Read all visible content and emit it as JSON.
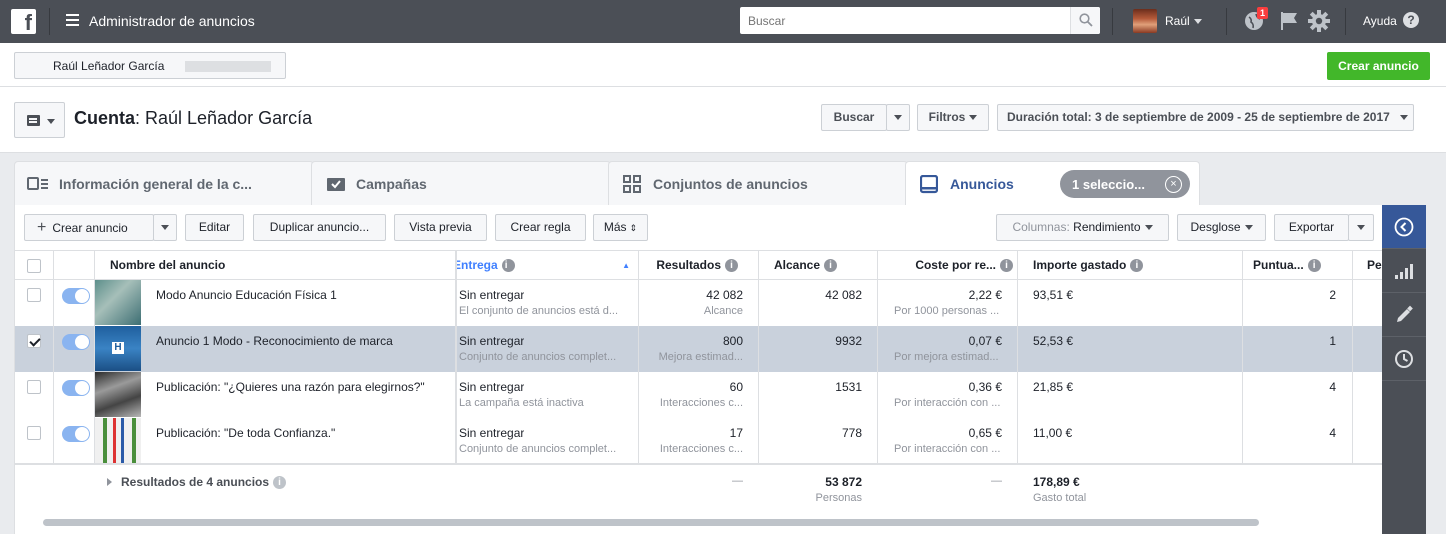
{
  "topbar": {
    "logo": "f",
    "app_title": "Administrador de anuncios",
    "search_placeholder": "Buscar",
    "user_name": "Raúl",
    "notification_count": "1",
    "help_label": "Ayuda",
    "help_icon": "?"
  },
  "account_bar": {
    "selected_account": "Raúl Leñador García",
    "create_ad_label": "Crear anuncio"
  },
  "header": {
    "account_prefix": "Cuenta",
    "account_name": ": Raúl Leñador García",
    "search_label": "Buscar",
    "filters_label": "Filtros",
    "date_range": "Duración total: 3 de septiembre de 2009 - 25 de septiembre de 2017"
  },
  "tabs": [
    {
      "label": "Información general de la c..."
    },
    {
      "label": "Campañas"
    },
    {
      "label": "Conjuntos de anuncios"
    },
    {
      "label": "Anuncios"
    }
  ],
  "selection_pill": {
    "label": "1 seleccio...",
    "close": "×"
  },
  "toolbar": {
    "create_ad": "Crear anuncio",
    "edit": "Editar",
    "duplicate": "Duplicar anuncio...",
    "preview": "Vista previa",
    "create_rule": "Crear regla",
    "more": "Más",
    "columns_prefix": "Columnas:",
    "columns_value": "Rendimiento",
    "breakdown": "Desglose",
    "export": "Exportar"
  },
  "columns": {
    "name": "Nombre del anuncio",
    "delivery": "Entrega",
    "results": "Resultados",
    "reach": "Alcance",
    "cost": "Coste por re...",
    "spent": "Importe gastado",
    "score": "Puntua...",
    "extra": "Pe"
  },
  "rows": [
    {
      "name": "Modo Anuncio Educación Física 1",
      "delivery": "Sin entregar",
      "delivery_sub": "El conjunto de anuncios está d...",
      "results": "42 082",
      "results_sub": "Alcance",
      "reach": "42 082",
      "cost": "2,22 €",
      "cost_sub": "Por 1000 personas ...",
      "spent": "93,51 €",
      "score": "2",
      "selected": false
    },
    {
      "name": "Anuncio 1 Modo - Reconocimiento de marca",
      "delivery": "Sin entregar",
      "delivery_sub": "Conjunto de anuncios complet...",
      "results": "800",
      "results_sub": "Mejora estimad...",
      "reach": "9932",
      "cost": "0,07 €",
      "cost_sub": "Por mejora estimad...",
      "spent": "52,53 €",
      "score": "1",
      "selected": true
    },
    {
      "name": "Publicación: \"¿Quieres una razón para elegirnos?\"",
      "delivery": "Sin entregar",
      "delivery_sub": "La campaña está inactiva",
      "results": "60",
      "results_sub": "Interacciones c...",
      "reach": "1531",
      "cost": "0,36 €",
      "cost_sub": "Por interacción con ...",
      "spent": "21,85 €",
      "score": "4",
      "selected": false
    },
    {
      "name": "Publicación: \"De toda Confianza.\"",
      "delivery": "Sin entregar",
      "delivery_sub": "Conjunto de anuncios complet...",
      "results": "17",
      "results_sub": "Interacciones c...",
      "reach": "778",
      "cost": "0,65 €",
      "cost_sub": "Por interacción con ...",
      "spent": "11,00 €",
      "score": "4",
      "selected": false
    }
  ],
  "footer": {
    "label": "Resultados de 4 anuncios",
    "results": "—",
    "reach": "53 872",
    "reach_sub": "Personas",
    "cost": "—",
    "spent": "178,89 €",
    "spent_sub": "Gasto total"
  },
  "colors": {
    "brand": "#4b4f56",
    "accent": "#365899",
    "green": "#42b72a",
    "toggle": "#8ab4f0",
    "selected_row": "#c9d1dc"
  },
  "icons": [
    "menu-icon",
    "search-icon",
    "globe-icon",
    "flag-icon",
    "gear-icon",
    "help-icon",
    "chevron-left-icon",
    "bar-chart-icon",
    "pencil-icon",
    "clock-icon"
  ]
}
